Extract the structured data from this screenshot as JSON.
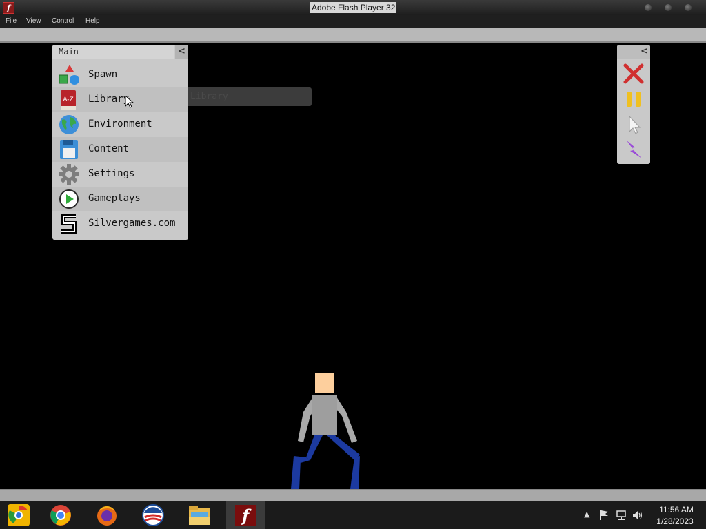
{
  "window": {
    "title": "Adobe Flash Player 32",
    "app_icon_glyph": "f"
  },
  "menubar": {
    "items": [
      "File",
      "View",
      "Control",
      "Help"
    ]
  },
  "main_panel": {
    "title": "Main",
    "collapse_glyph": "<",
    "items": [
      {
        "label": "Spawn",
        "icon": "shapes-icon"
      },
      {
        "label": "Library",
        "icon": "book-a-z-icon"
      },
      {
        "label": "Environment",
        "icon": "globe-icon"
      },
      {
        "label": "Content",
        "icon": "floppy-disk-icon"
      },
      {
        "label": "Settings",
        "icon": "gear-icon"
      },
      {
        "label": "Gameplays",
        "icon": "play-icon"
      },
      {
        "label": "Silvergames.com",
        "icon": "silvergames-logo-icon"
      }
    ],
    "book_icon_text": "A-Z"
  },
  "tooltip": {
    "text": "Library"
  },
  "tool_panel": {
    "collapse_glyph": "<",
    "tools": [
      "close-x-icon",
      "pause-icon",
      "pointer-icon",
      "lightning-icon"
    ]
  },
  "taskbar": {
    "apps": [
      "chrome-canary-icon",
      "chrome-icon",
      "firefox-icon",
      "obama-logo-icon",
      "file-explorer-icon",
      "flash-player-icon"
    ],
    "flash_glyph": "f",
    "tray_arrow": "▲",
    "clock_time": "11:56 AM",
    "clock_date": "1/28/2023"
  },
  "colors": {
    "background": "#000000",
    "panel": "#c9c9c9",
    "ragdoll_head": "#fdcf9d",
    "ragdoll_torso": "#9e9e9e",
    "ragdoll_legs": "#1c3aa0"
  }
}
